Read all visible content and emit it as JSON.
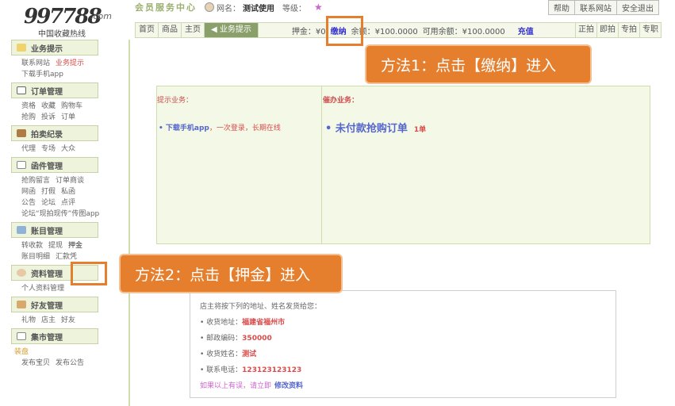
{
  "logo": {
    "number": "997788",
    "suffix": ".com",
    "tagline": "中国收藏热线"
  },
  "header": {
    "member_center": "会员服务中心",
    "username_label": "网名：",
    "username": "测试使用",
    "level_label": "等级：",
    "level_star": "★",
    "links": [
      "帮助",
      "联系网站",
      "安全退出"
    ]
  },
  "nav": {
    "tabs": [
      "首页",
      "商品",
      "主页"
    ],
    "active_tab": "业务提示",
    "deposit_label": "押金：¥0",
    "pay_label": "缴纳",
    "balance_label": "余额：¥100.0000",
    "available_label": "可用余额：¥100.0000",
    "charge_label": "充值",
    "right_tabs": [
      "正拍",
      "即拍",
      "专拍",
      "专职"
    ]
  },
  "sidebar": {
    "sections": [
      {
        "title": "业务提示",
        "lines": [
          [
            "联系网站",
            "业务提示"
          ],
          [
            "下载手机app"
          ]
        ]
      },
      {
        "title": "订单管理",
        "lines": [
          [
            "资格",
            "收藏",
            "购物车"
          ],
          [
            "抢购",
            "投诉",
            "订单"
          ]
        ]
      },
      {
        "title": "拍卖纪录",
        "lines": [
          [
            "代理",
            "专场",
            "大众"
          ]
        ]
      },
      {
        "title": "函件管理",
        "lines": [
          [
            "抢购留言",
            "订单商谈"
          ],
          [
            "网函",
            "打假",
            "私函"
          ],
          [
            "公告",
            "论坛",
            "点评"
          ],
          [
            "论坛“现拍现传”传图app"
          ]
        ]
      },
      {
        "title": "账目管理",
        "lines": [
          [
            "转收款",
            "提现",
            "押金"
          ],
          [
            "账目明细",
            "汇款凭"
          ]
        ]
      },
      {
        "title": "资料管理",
        "lines": [
          [
            "个人资料管理"
          ]
        ]
      },
      {
        "title": "好友管理",
        "lines": [
          [
            "礼物",
            "店主",
            "好友"
          ]
        ]
      },
      {
        "title": "集市管理",
        "lines": [
          [
            "装盘"
          ],
          [
            "发布宝贝",
            "发布公告"
          ]
        ]
      }
    ]
  },
  "main": {
    "tips_header": "提示业务：",
    "todo_header": "催办业务：",
    "tip_item_link": "• 下载手机app",
    "tip_item_rest": "，一次登录，长期在线",
    "todo_item": "• 未付款抢购订单",
    "todo_count": "1单",
    "shipping": {
      "intro": "店主将按下列的地址、姓名发货给您：",
      "address_label": "• 收货地址：",
      "address": "福建省福州市",
      "zip_label": "• 邮政编码：",
      "zip": "350000",
      "name_label": "• 收货姓名：",
      "name": "测试",
      "phone_label": "• 联系电话：",
      "phone": "123123123123",
      "note": "如果以上有误，请立即",
      "edit_link": "修改资料"
    }
  },
  "callouts": {
    "method1": "方法1：点击【缴纳】进入",
    "method2": "方法2：点击【押金】进入"
  },
  "colors": {
    "accent": "#e57f2e",
    "link": "#5566cc",
    "alert": "#d94c4c",
    "panel": "#f4f8e6"
  }
}
